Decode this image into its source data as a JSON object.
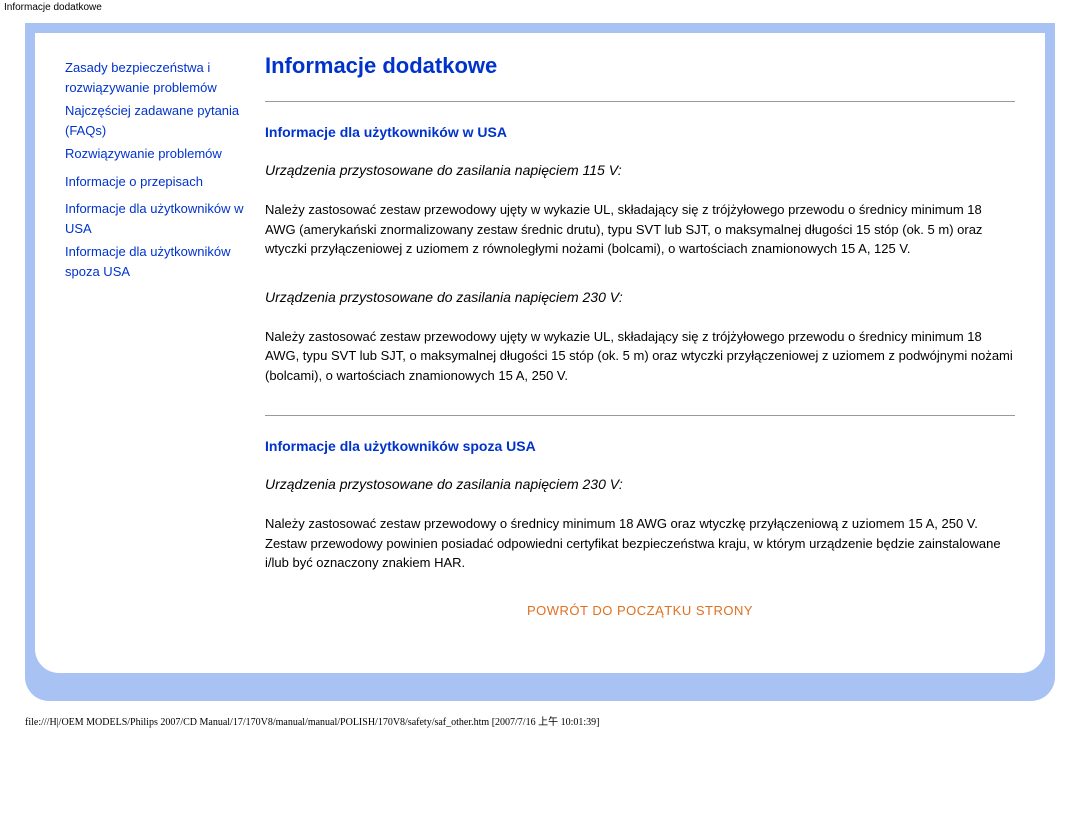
{
  "header": {
    "title": "Informacje dodatkowe"
  },
  "sidebar": {
    "links": [
      "Zasady bezpieczeństwa i rozwiązywanie problemów",
      "Najczęściej  zadawane pytania (FAQs)",
      "Rozwiązywanie problemów",
      "Informacje o przepisach",
      "Informacje dla użytkowników w USA",
      "Informacje dla użytkowników spoza USA"
    ]
  },
  "main": {
    "title": "Informacje dodatkowe",
    "sections": [
      {
        "heading": "Informacje dla użytkowników w USA",
        "blocks": [
          {
            "sub": "Urządzenia przystosowane do zasilania napięciem 115 V:",
            "text": "Należy zastosować zestaw przewodowy ujęty w wykazie UL, składający się z trójżyłowego przewodu o średnicy minimum 18 AWG (amerykański znormalizowany zestaw średnic drutu), typu SVT lub SJT, o maksymalnej długości 15 stóp (ok. 5 m) oraz wtyczki przyłączeniowej z uziomem z równoległymi nożami (bolcami), o wartościach znamionowych 15 A, 125 V."
          },
          {
            "sub": "Urządzenia przystosowane do zasilania napięciem 230 V:",
            "text": "Należy zastosować zestaw przewodowy ujęty w wykazie UL, składający się z trójżyłowego przewodu o średnicy minimum 18 AWG, typu SVT lub SJT, o maksymalnej długości 15 stóp (ok. 5 m) oraz wtyczki przyłączeniowej z uziomem z podwójnymi nożami (bolcami), o wartościach znamionowych 15 A, 250 V."
          }
        ]
      },
      {
        "heading": "Informacje dla użytkowników spoza USA",
        "blocks": [
          {
            "sub": "Urządzenia przystosowane do zasilania napięciem 230 V:",
            "text": "Należy zastosować zestaw przewodowy o średnicy minimum 18 AWG oraz wtyczkę przyłączeniową z uziomem 15 A, 250 V. Zestaw przewodowy powinien posiadać odpowiedni certyfikat bezpieczeństwa kraju, w którym urządzenie będzie zainstalowane i/lub być oznaczony znakiem HAR."
          }
        ]
      }
    ],
    "back_link": "POWRÓT DO POCZĄTKU STRONY"
  },
  "footer": {
    "path": "file:///H|/OEM MODELS/Philips 2007/CD Manual/17/170V8/manual/manual/POLISH/170V8/safety/saf_other.htm [2007/7/16 上午 10:01:39]"
  }
}
